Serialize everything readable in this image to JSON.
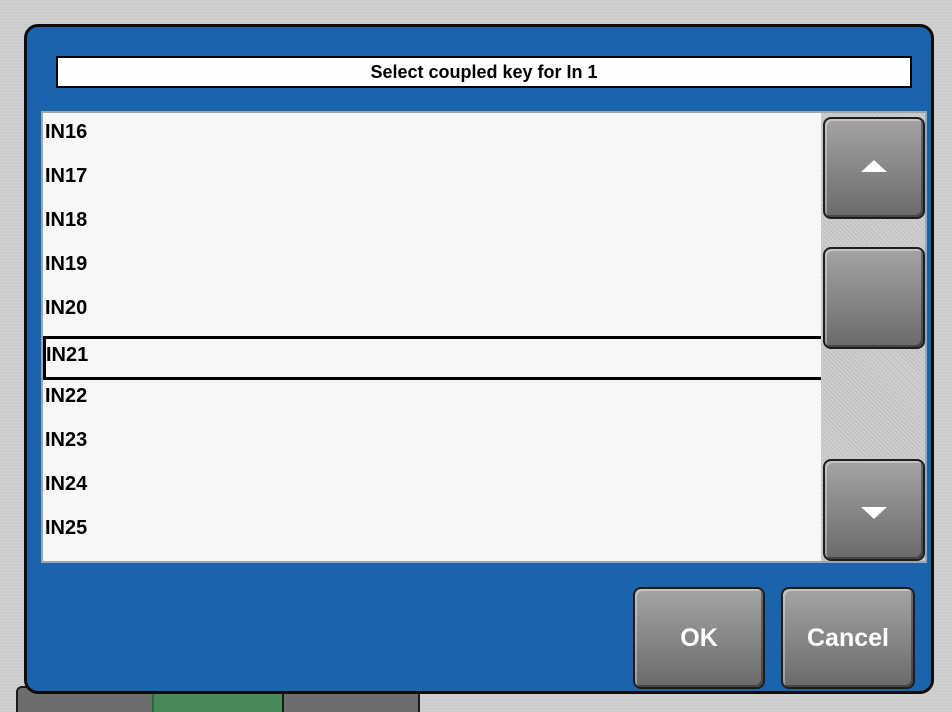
{
  "dialog": {
    "title": "Select coupled key for In 1",
    "ok_label": "OK",
    "cancel_label": "Cancel"
  },
  "list": {
    "items": [
      "IN16",
      "IN17",
      "IN18",
      "IN19",
      "IN20",
      "IN21",
      "IN22",
      "IN23",
      "IN24",
      "IN25"
    ],
    "selected": "IN21"
  },
  "colors": {
    "dialog_background": "#1b64ac",
    "list_background": "#f6f8f6",
    "button_gray": "#8a8a8a"
  },
  "icons": {
    "scroll_up": "triangle-up-icon",
    "scroll_down": "triangle-down-icon"
  }
}
